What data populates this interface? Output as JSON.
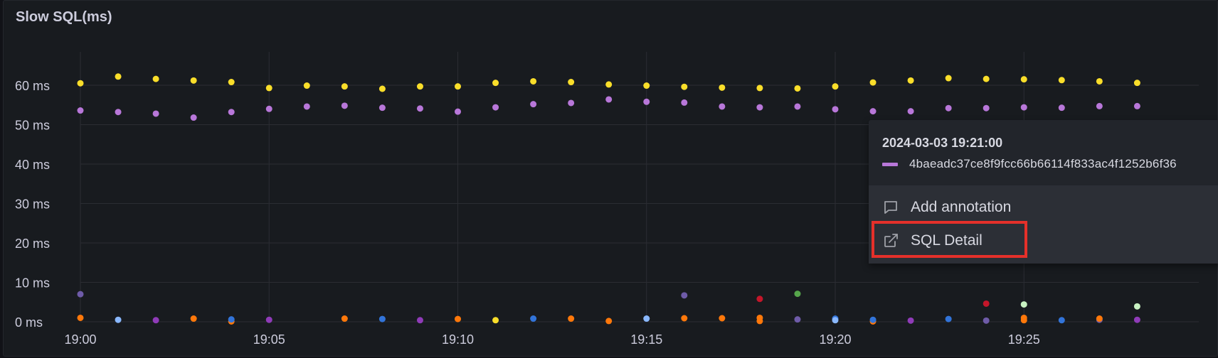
{
  "panel": {
    "title": "Slow SQL(ms)"
  },
  "colors": {
    "background": "#181b1f",
    "grid": "#2b2d33",
    "text": "#ccccdc",
    "yellow": "#fade2a",
    "purple": "#b877d9",
    "blue": "#3274d9",
    "light_blue": "#8ab8ff",
    "orange": "#ff780a",
    "dark_purple": "#6e5ba8",
    "red": "#c4162a",
    "green": "#56a64b",
    "light_green": "#c8f2c2",
    "highlight": "#e5302a"
  },
  "chart_data": {
    "type": "scatter",
    "title": "Slow SQL(ms)",
    "x": [
      "19:00",
      "19:01",
      "19:02",
      "19:03",
      "19:04",
      "19:05",
      "19:06",
      "19:07",
      "19:08",
      "19:09",
      "19:10",
      "19:11",
      "19:12",
      "19:13",
      "19:14",
      "19:15",
      "19:16",
      "19:17",
      "19:18",
      "19:19",
      "19:20",
      "19:21",
      "19:22",
      "19:23",
      "19:24",
      "19:25",
      "19:26",
      "19:27",
      "19:28"
    ],
    "xticks": [
      "19:00",
      "19:05",
      "19:10",
      "19:15",
      "19:20",
      "19:25"
    ],
    "yticks": [
      "0 ms",
      "10 ms",
      "20 ms",
      "30 ms",
      "40 ms",
      "50 ms",
      "60 ms"
    ],
    "ylim": [
      0,
      70
    ],
    "y_unit": "ms",
    "grid": true,
    "series": [
      {
        "color": "#fade2a",
        "values": [
          60.5,
          62.2,
          61.6,
          61.2,
          60.8,
          59.3,
          59.9,
          59.7,
          59.1,
          59.7,
          59.7,
          60.6,
          61.0,
          60.8,
          60.2,
          59.9,
          59.6,
          59.4,
          59.3,
          59.2,
          59.7,
          60.7,
          61.2,
          61.8,
          61.6,
          61.5,
          61.3,
          61.0,
          60.6
        ]
      },
      {
        "color": "#b877d9",
        "values": [
          53.6,
          53.2,
          52.8,
          51.8,
          53.2,
          54.0,
          54.6,
          54.8,
          54.3,
          54.1,
          53.3,
          54.4,
          55.2,
          55.5,
          56.4,
          55.8,
          55.6,
          54.6,
          54.4,
          54.6,
          53.9,
          53.4,
          53.4,
          54.2,
          54.2,
          54.4,
          54.3,
          54.7,
          54.7
        ]
      },
      {
        "color": "#6e5ba8",
        "points": [
          [
            "19:00",
            7.0
          ],
          [
            "19:16",
            6.7
          ],
          [
            "19:19",
            0.6
          ],
          [
            "19:24",
            0.3
          ],
          [
            "19:27",
            0.5
          ]
        ]
      },
      {
        "color": "#ff780a",
        "points": [
          [
            "19:00",
            1.0
          ],
          [
            "19:03",
            0.8
          ],
          [
            "19:04",
            0.1
          ],
          [
            "19:07",
            0.8
          ],
          [
            "19:10",
            0.7
          ],
          [
            "19:13",
            0.8
          ],
          [
            "19:14",
            0.2
          ],
          [
            "19:16",
            0.9
          ],
          [
            "19:17",
            0.9
          ],
          [
            "19:18",
            1.0
          ],
          [
            "19:18",
            0.2
          ],
          [
            "19:21",
            0.1
          ],
          [
            "19:25",
            1.0
          ],
          [
            "19:25",
            0.4
          ],
          [
            "19:27",
            0.8
          ]
        ]
      },
      {
        "color": "#3274d9",
        "points": [
          [
            "19:04",
            0.6
          ],
          [
            "19:08",
            0.7
          ],
          [
            "19:12",
            0.8
          ],
          [
            "19:20",
            0.8
          ],
          [
            "19:21",
            0.5
          ],
          [
            "19:23",
            0.7
          ],
          [
            "19:26",
            0.4
          ]
        ]
      },
      {
        "color": "#8ab8ff",
        "points": [
          [
            "19:01",
            0.5
          ],
          [
            "19:15",
            0.8
          ],
          [
            "19:20",
            0.4
          ]
        ]
      },
      {
        "color": "#fade2a",
        "points": [
          [
            "19:11",
            0.4
          ]
        ]
      },
      {
        "color": "#c4162a",
        "points": [
          [
            "19:18",
            5.8
          ],
          [
            "19:24",
            4.6
          ]
        ]
      },
      {
        "color": "#56a64b",
        "points": [
          [
            "19:19",
            7.1
          ]
        ]
      },
      {
        "color": "#c8f2c2",
        "points": [
          [
            "19:25",
            4.4
          ],
          [
            "19:28",
            3.9
          ]
        ]
      },
      {
        "color": "#8f3bb8",
        "points": [
          [
            "19:02",
            0.4
          ],
          [
            "19:05",
            0.5
          ],
          [
            "19:09",
            0.4
          ],
          [
            "19:22",
            0.3
          ],
          [
            "19:28",
            0.5
          ]
        ]
      }
    ]
  },
  "tooltip": {
    "time": "2024-03-03 19:21:00",
    "series_id": "4baeadc37ce8f9fcc66b66114f833ac4f1252b6f36",
    "series_color": "#b877d9",
    "menu": {
      "add_annotation": "Add annotation",
      "sql_detail": "SQL Detail"
    }
  }
}
